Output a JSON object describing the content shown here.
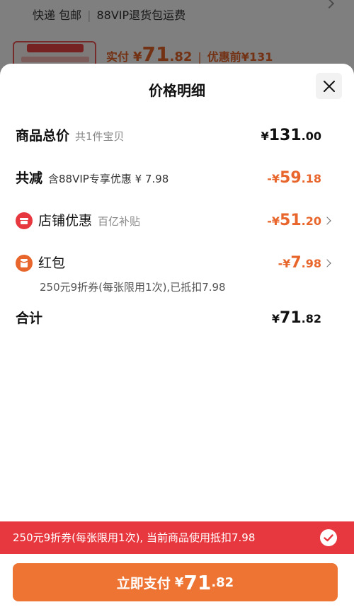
{
  "background_page": {
    "shipping": "快递 包邮",
    "vip_return": "88VIP退货包运费",
    "paid_label": "实付",
    "paid_currency": "¥",
    "paid_int": "71",
    "paid_dec": ".82",
    "original_label": "优惠前",
    "original_price": "¥131"
  },
  "sheet": {
    "title": "价格明细",
    "close_icon": "close-icon"
  },
  "rows": {
    "total": {
      "label": "商品总价",
      "sub": "共1件宝贝",
      "currency": "¥",
      "int": "131",
      "dec": ".00"
    },
    "reduction": {
      "label": "共减",
      "sub": "含88VIP专享优惠 ¥ 7.98",
      "currency": "-¥",
      "int": "59",
      "dec": ".18"
    },
    "shop_discount": {
      "icon": "shop-icon",
      "label": "店铺优惠",
      "sub": "百亿补贴",
      "currency": "-¥",
      "int": "51",
      "dec": ".20"
    },
    "red_packet": {
      "icon": "red-packet-icon",
      "label": "红包",
      "currency": "-¥",
      "int": "7",
      "dec": ".98",
      "note": "250元9折券(每张限用1次),已抵扣7.98"
    },
    "sum": {
      "label": "合计",
      "currency": "¥",
      "int": "71",
      "dec": ".82"
    }
  },
  "banner": {
    "text": "250元9折券(每张限用1次), 当前商品使用抵扣7.98",
    "icon": "check-circle-icon"
  },
  "pay_button": {
    "label": "立即支付",
    "currency": "¥",
    "int": "71",
    "dec": ".82"
  },
  "colors": {
    "accent_orange": "#e8652b",
    "banner_red": "#e8383f",
    "button_orange": "#ee7434"
  }
}
